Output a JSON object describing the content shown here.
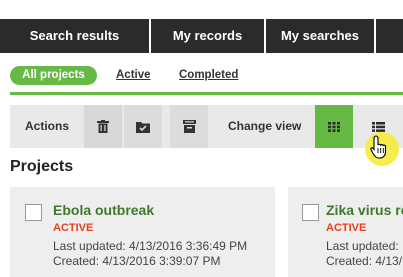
{
  "tabs": {
    "search_results": "Search results",
    "my_records": "My records",
    "my_searches": "My searches"
  },
  "filters": {
    "all_projects": "All projects",
    "active": "Active",
    "completed": "Completed"
  },
  "toolbar": {
    "actions": "Actions",
    "change_view": "Change view"
  },
  "section": {
    "title": "Projects"
  },
  "cards": [
    {
      "title": "Ebola outbreak",
      "status": "ACTIVE",
      "last_updated": "Last updated: 4/13/2016 3:36:49 PM",
      "created": "Created: 4/13/2016 3:39:07 PM"
    },
    {
      "title": "Zika virus re",
      "status": "ACTIVE",
      "last_updated": "Last updated: ",
      "created": "Created: 4/13/"
    }
  ],
  "colors": {
    "accent": "#67b946",
    "dark": "#2b2b2b",
    "status": "#e8401c"
  },
  "icons": [
    "trash-icon",
    "folder-check-icon",
    "archive-icon",
    "grid-view-icon",
    "list-view-icon",
    "hand-cursor-icon"
  ]
}
